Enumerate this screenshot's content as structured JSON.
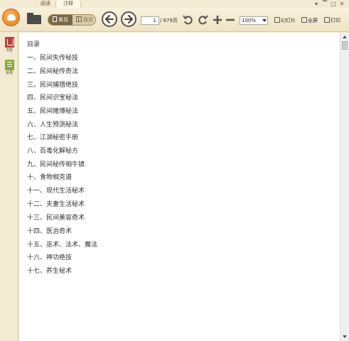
{
  "tabs": [
    {
      "label": "阅读"
    },
    {
      "label": "注释"
    }
  ],
  "window_controls": [
    "▾",
    "▔",
    "□",
    "✕"
  ],
  "toolbar": {
    "view_single": "单页",
    "view_double": "双页",
    "page_current": "1",
    "page_total": "/ 679页",
    "zoom": "100%",
    "slideshow": "幻灯片",
    "fullscreen": "全屏",
    "print": "打印"
  },
  "sidebar": {
    "items": [
      {
        "label": "书签",
        "icon": "bookmark-icon"
      },
      {
        "label": "目录",
        "icon": "toc-icon"
      }
    ]
  },
  "document": {
    "title": "目录",
    "items": [
      "一、民间失传秘技",
      "二、民间秘传奇法",
      "三、民间捕猎绝技",
      "四、民间识宝秘法",
      "五、民间赌博秘法",
      "六、人生预测秘法",
      "七、江湖秘密手册",
      "八、百毒化解秘方",
      "九、民间秘传相牛镜",
      "十、食物相克谱",
      "十一、现代生活秘术",
      "十二、夫妻生活秘术",
      "十三、民间美容奇术",
      "十四、医治奇术",
      "十五、巫术、法术、魔法",
      "十六、神功绝技",
      "十七、养生秘术"
    ]
  },
  "colors": {
    "chrome": "#f3ead3",
    "accent_orange": "#e07d1d",
    "bookmark_red": "#b7423b",
    "toc_green": "#8aa83c"
  }
}
